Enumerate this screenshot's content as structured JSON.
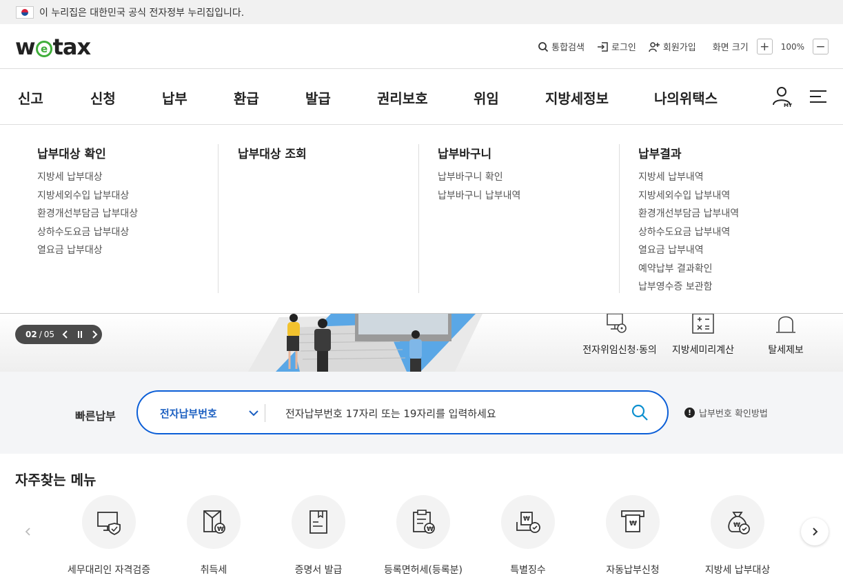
{
  "gov_banner": {
    "text": "이 누리집은 대한민국 공식 전자정부 누리집입니다."
  },
  "header": {
    "logo_text_a": "w",
    "logo_text_e": "e",
    "logo_text_b": "tax",
    "search": "통합검색",
    "login": "로그인",
    "signup": "회원가입",
    "zoom_label": "화면 크기",
    "zoom_in": "+",
    "zoom_value": "100%",
    "zoom_out": "−"
  },
  "gnb": {
    "items": [
      "신고",
      "신청",
      "납부",
      "환급",
      "발급",
      "권리보호",
      "위임",
      "지방세정보",
      "나의위택스"
    ]
  },
  "mega": {
    "columns": [
      {
        "title": "납부대상 확인",
        "links": [
          "지방세 납부대상",
          "지방세외수입 납부대상",
          "환경개선부담금 납부대상",
          "상하수도요금 납부대상",
          "열요금 납부대상"
        ]
      },
      {
        "title": "납부대상 조회",
        "links": []
      },
      {
        "title": "납부바구니",
        "links": [
          "납부바구니 확인",
          "납부바구니 납부내역"
        ]
      },
      {
        "title": "납부결과",
        "links": [
          "지방세 납부내역",
          "지방세외수입 납부내역",
          "환경개선부담금 납부내역",
          "상하수도요금 납부내역",
          "열요금 납부내역",
          "예약납부 결과확인",
          "납부영수증 보관함"
        ]
      }
    ]
  },
  "hero": {
    "pager_current": "02",
    "pager_sep": "/",
    "pager_total": "05",
    "quick_links": [
      "전자위임신청·동의",
      "지방세미리계산",
      "탈세제보"
    ]
  },
  "fastpay": {
    "label": "빠른납부",
    "select_value": "전자납부번호",
    "placeholder": "전자납부번호 17자리 또는 19자리를 입력하세요",
    "help": "납부번호 확인방법",
    "help_icon": "!"
  },
  "favorites": {
    "title": "자주찾는 메뉴",
    "items": [
      "세무대리인 자격검증",
      "취득세",
      "증명서 발급",
      "등록면허세(등록분)",
      "특별징수",
      "자동납부신청",
      "지방세 납부대상"
    ]
  },
  "colors": {
    "accent": "#0b5ed7",
    "logo_green": "#3fae3a",
    "select_text": "#1b5fc1"
  }
}
